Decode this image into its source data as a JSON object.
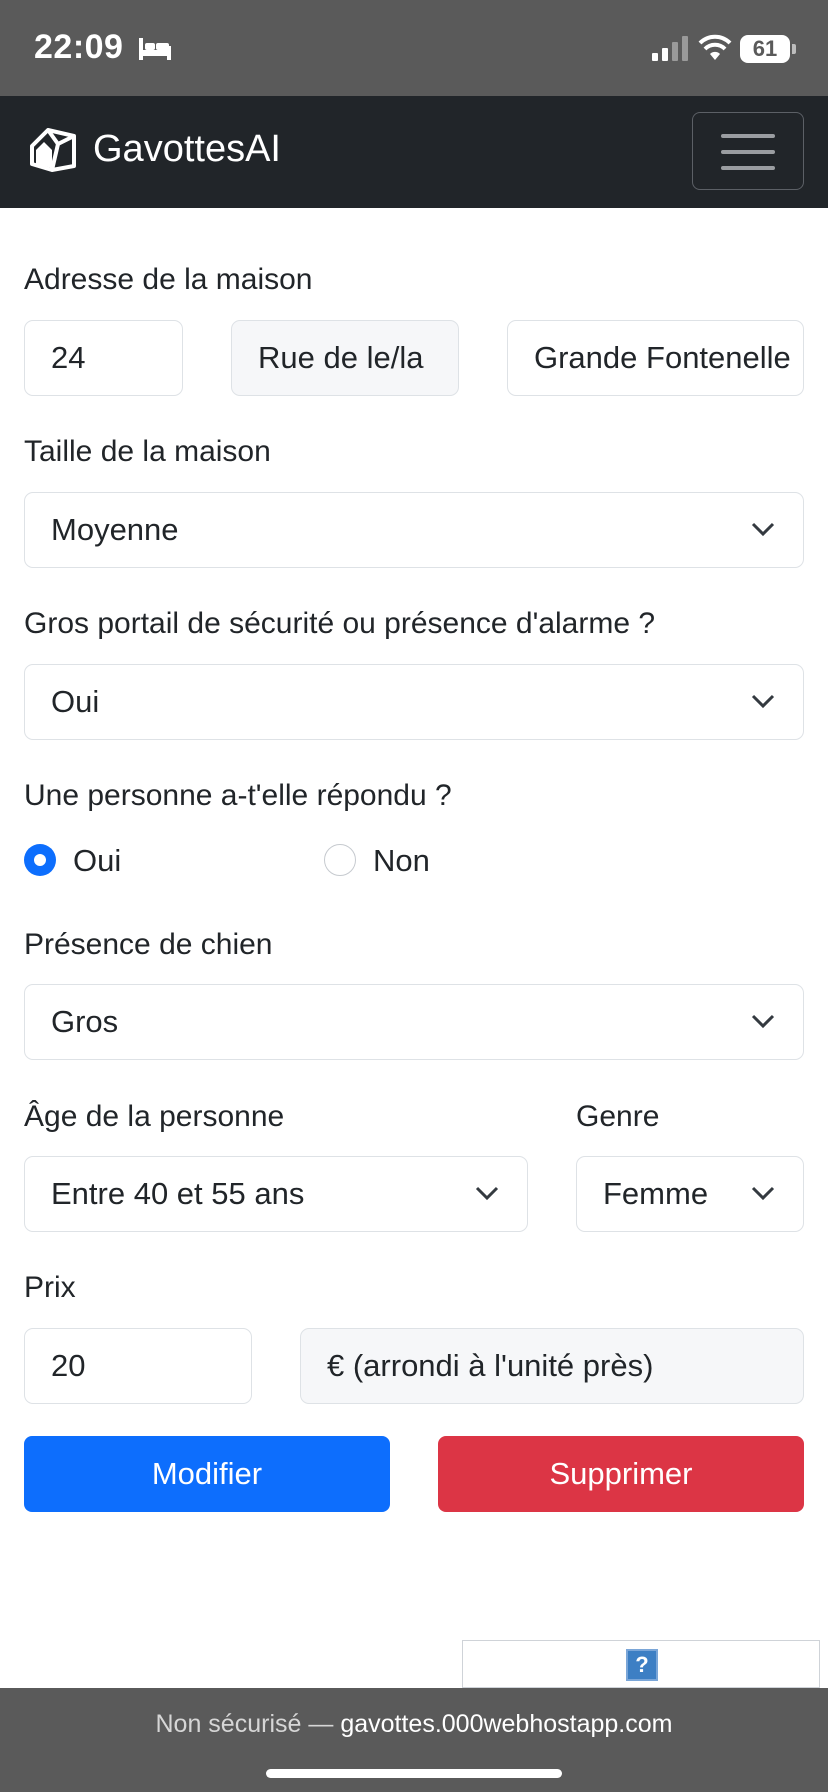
{
  "status_bar": {
    "time": "22:09",
    "sleep_icon": "bed-icon",
    "battery_level": "61"
  },
  "navbar": {
    "brand": "GavottesAI",
    "brand_icon": "house-icon",
    "menu_icon": "hamburger-icon"
  },
  "form": {
    "address": {
      "label": "Adresse de la maison",
      "number": "24",
      "street_type": "Rue de le/la",
      "street_name": "Grande Fontenelle"
    },
    "house_size": {
      "label": "Taille de la maison",
      "value": "Moyenne"
    },
    "security": {
      "label": "Gros portail de sécurité ou présence d'alarme ?",
      "value": "Oui"
    },
    "answered": {
      "label": "Une personne a-t'elle répondu ?",
      "options": [
        "Oui",
        "Non"
      ],
      "selected": "Oui"
    },
    "dog": {
      "label": "Présence de chien",
      "value": "Gros"
    },
    "age": {
      "label": "Âge de la personne",
      "value": "Entre 40 et 55 ans"
    },
    "gender": {
      "label": "Genre",
      "value": "Femme"
    },
    "price": {
      "label": "Prix",
      "value": "20",
      "unit": "€ (arrondi à l'unité près)"
    },
    "buttons": {
      "modify": "Modifier",
      "delete": "Supprimer"
    }
  },
  "colors": {
    "primary": "#0d6efd",
    "danger": "#dc3545",
    "navbar": "#212529"
  },
  "browser": {
    "insecure_label": "Non sécurisé —",
    "domain": "gavottes.000webhostapp.com",
    "help_icon": "?"
  }
}
